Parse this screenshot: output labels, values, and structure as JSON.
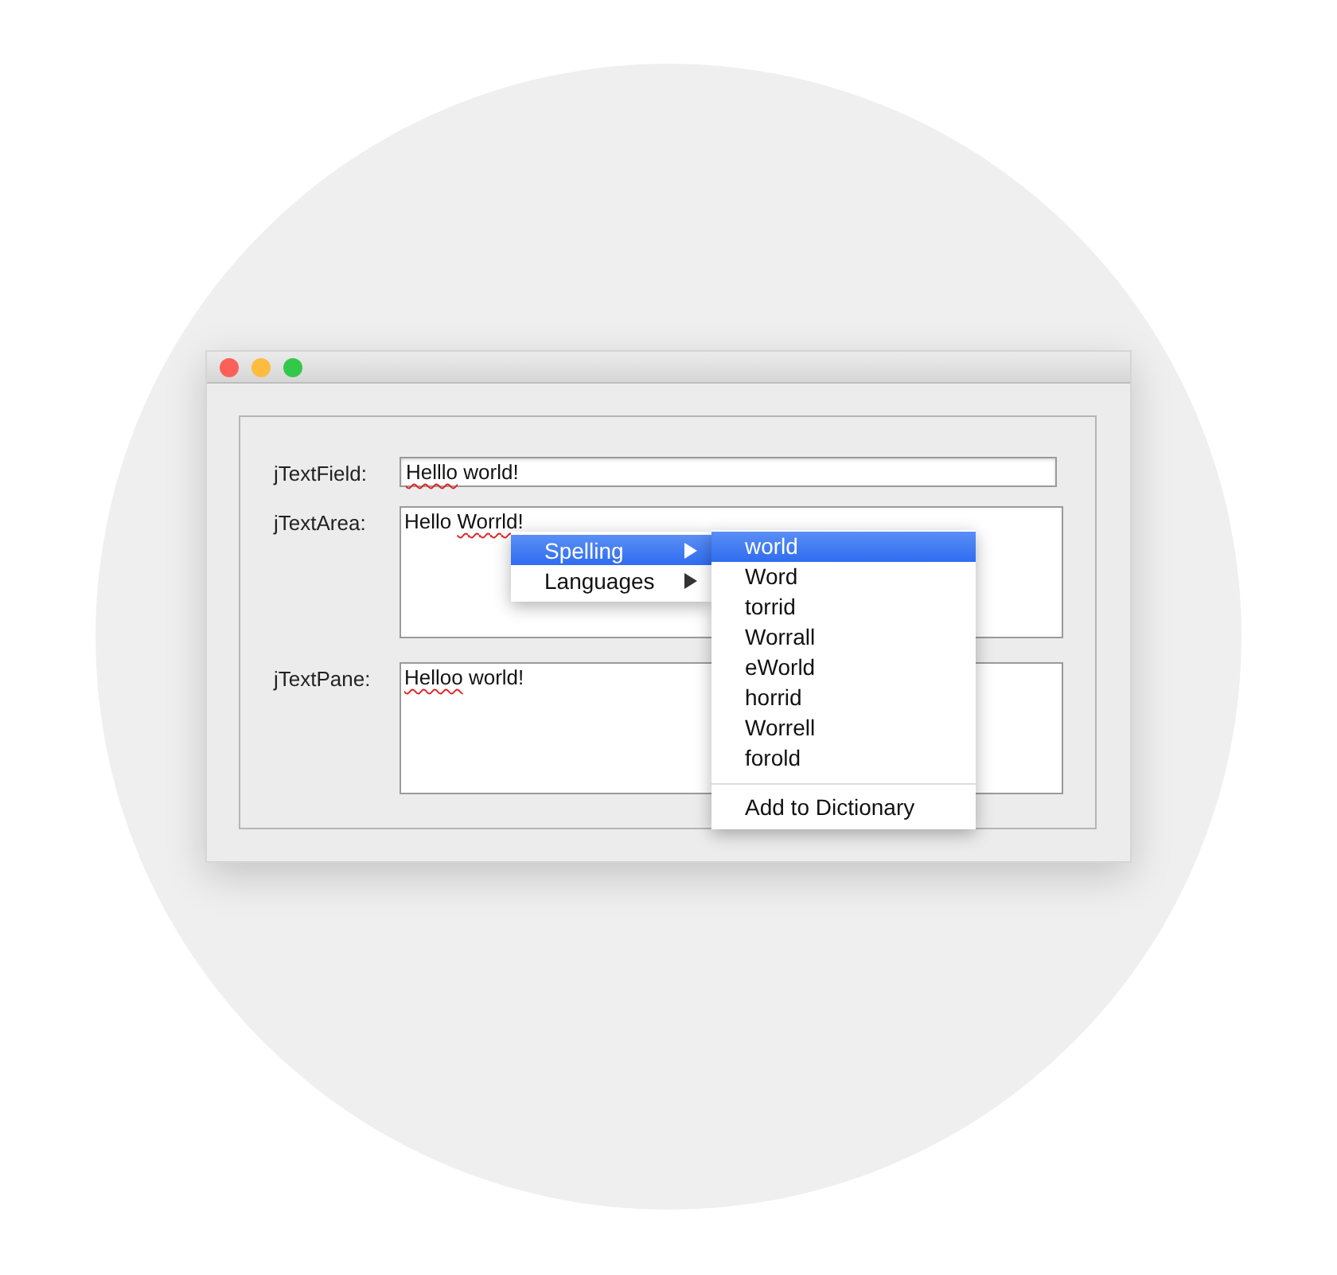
{
  "window": {
    "controls": [
      {
        "kind": "close"
      },
      {
        "kind": "minimize"
      },
      {
        "kind": "zoom"
      }
    ]
  },
  "fields": [
    {
      "label": "jTextField:",
      "kind": "field",
      "value": [
        {
          "text": "Helllo",
          "misspelled": true
        },
        {
          "text": " world!",
          "misspelled": false
        }
      ]
    },
    {
      "label": "jTextArea:",
      "kind": "area",
      "value": [
        {
          "text": "Hello ",
          "misspelled": false
        },
        {
          "text": "Worrld!",
          "misspelled": true
        }
      ]
    },
    {
      "label": "jTextPane:",
      "kind": "area",
      "value": [
        {
          "text": "Helloo",
          "misspelled": true
        },
        {
          "text": " world!",
          "misspelled": false
        }
      ]
    }
  ],
  "context_menu": {
    "items": [
      {
        "label": "Spelling",
        "selected": true,
        "submenu": true
      },
      {
        "label": "Languages",
        "selected": false,
        "submenu": true
      }
    ]
  },
  "submenu": {
    "items": [
      {
        "label": "world",
        "selected": true
      },
      {
        "label": "Word",
        "selected": false
      },
      {
        "label": "torrid",
        "selected": false
      },
      {
        "label": "Worrall",
        "selected": false
      },
      {
        "label": "eWorld",
        "selected": false
      },
      {
        "label": "horrid",
        "selected": false
      },
      {
        "label": "Worrell",
        "selected": false
      },
      {
        "label": "forold",
        "selected": false
      }
    ],
    "footer_items": [
      {
        "label": "Add to Dictionary",
        "selected": false
      }
    ]
  }
}
